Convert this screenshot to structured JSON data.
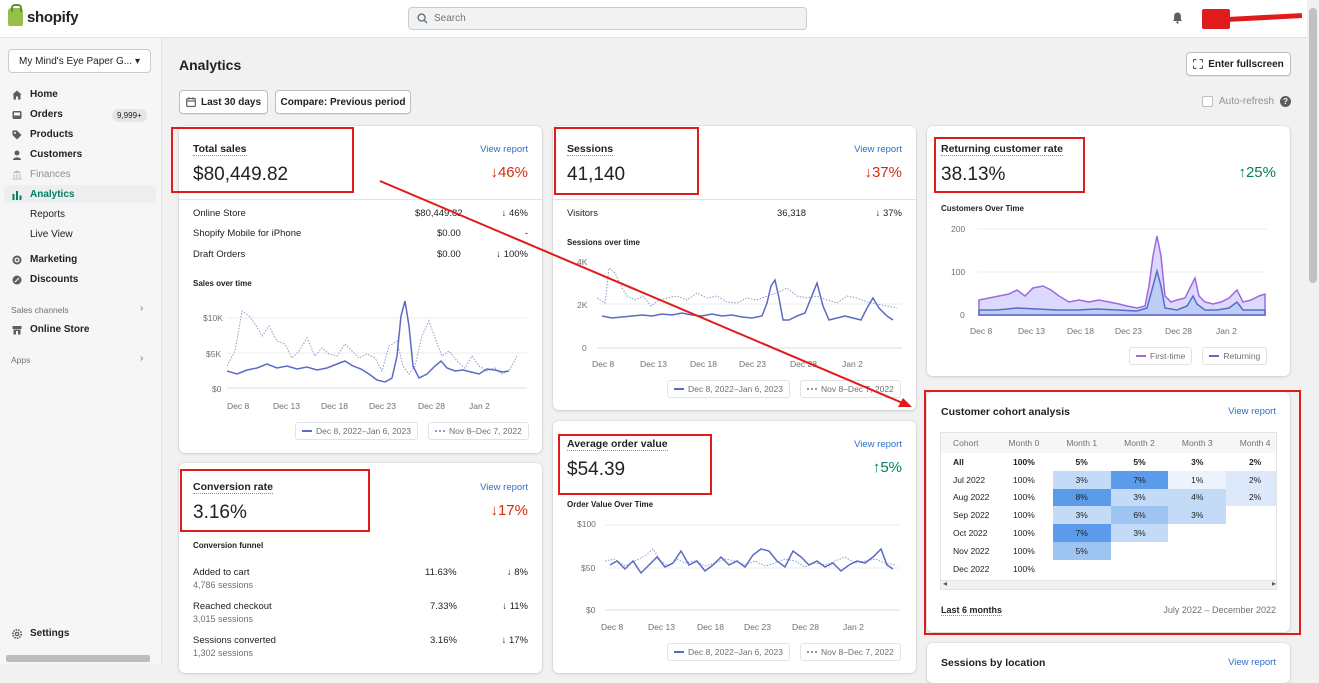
{
  "topbar": {
    "logo_text": "shopify",
    "search_placeholder": "Search"
  },
  "sidebar": {
    "store_name": "My Mind's Eye Paper G...",
    "items": [
      {
        "label": "Home",
        "icon": "home-icon"
      },
      {
        "label": "Orders",
        "icon": "orders-icon",
        "badge": "9,999+"
      },
      {
        "label": "Products",
        "icon": "tag-icon"
      },
      {
        "label": "Customers",
        "icon": "person-icon"
      },
      {
        "label": "Finances",
        "icon": "bank-icon"
      },
      {
        "label": "Analytics",
        "icon": "bar-chart-icon"
      },
      {
        "label": "Reports"
      },
      {
        "label": "Live View"
      },
      {
        "label": "Marketing",
        "icon": "target-icon"
      },
      {
        "label": "Discounts",
        "icon": "discount-icon"
      }
    ],
    "sales_channels_label": "Sales channels",
    "online_store_label": "Online Store",
    "apps_label": "Apps",
    "settings_label": "Settings"
  },
  "page": {
    "title": "Analytics",
    "fullscreen_label": "Enter fullscreen",
    "date_range_label": "Last 30 days",
    "compare_label": "Compare: Previous period",
    "auto_refresh_label": "Auto-refresh"
  },
  "view_report": "View report",
  "total_sales": {
    "title": "Total sales",
    "value": "$80,449.82",
    "change": "46%",
    "direction": "down",
    "rows": [
      {
        "label": "Online Store",
        "value": "$80,449.82",
        "change": "46%"
      },
      {
        "label": "Shopify Mobile for iPhone",
        "value": "$0.00",
        "change": "-"
      },
      {
        "label": "Draft Orders",
        "value": "$0.00",
        "change": "100%"
      }
    ],
    "chart_label": "Sales over time",
    "y_ticks": [
      "$10K",
      "$5K",
      "$0"
    ],
    "x_ticks": [
      "Dec 8",
      "Dec 13",
      "Dec 18",
      "Dec 23",
      "Dec 28",
      "Jan 2"
    ],
    "legend_current": "Dec 8, 2022–Jan 6, 2023",
    "legend_previous": "Nov 8–Dec 7, 2022"
  },
  "sessions": {
    "title": "Sessions",
    "value": "41,140",
    "change": "37%",
    "direction": "down",
    "visitors_label": "Visitors",
    "visitors_value": "36,318",
    "visitors_change": "37%",
    "chart_label": "Sessions over time",
    "y_ticks": [
      "4K",
      "2K",
      "0"
    ],
    "x_ticks": [
      "Dec 8",
      "Dec 13",
      "Dec 18",
      "Dec 23",
      "Dec 28",
      "Jan 2"
    ],
    "legend_current": "Dec 8, 2022–Jan 6, 2023",
    "legend_previous": "Nov 8–Dec 7, 2022"
  },
  "returning": {
    "title": "Returning customer rate",
    "value": "38.13%",
    "change": "25%",
    "direction": "up",
    "chart_label": "Customers Over Time",
    "y_ticks": [
      "200",
      "100",
      "0"
    ],
    "x_ticks": [
      "Dec 8",
      "Dec 13",
      "Dec 18",
      "Dec 23",
      "Dec 28",
      "Jan 2"
    ],
    "legend_first": "First-time",
    "legend_returning": "Returning"
  },
  "conversion": {
    "title": "Conversion rate",
    "value": "3.16%",
    "change": "17%",
    "direction": "down",
    "funnel_label": "Conversion funnel",
    "rows": [
      {
        "label": "Added to cart",
        "sub": "4,786 sessions",
        "value": "11.63%",
        "change": "8%"
      },
      {
        "label": "Reached checkout",
        "sub": "3,015 sessions",
        "value": "7.33%",
        "change": "11%"
      },
      {
        "label": "Sessions converted",
        "sub": "1,302 sessions",
        "value": "3.16%",
        "change": "17%"
      }
    ]
  },
  "aov": {
    "title": "Average order value",
    "value": "$54.39",
    "change": "5%",
    "direction": "up",
    "chart_label": "Order Value Over Time",
    "y_ticks": [
      "$100",
      "$50",
      "$0"
    ],
    "x_ticks": [
      "Dec 8",
      "Dec 13",
      "Dec 18",
      "Dec 23",
      "Dec 28",
      "Jan 2"
    ],
    "legend_current": "Dec 8, 2022–Jan 6, 2023",
    "legend_previous": "Nov 8–Dec 7, 2022"
  },
  "cohort": {
    "title": "Customer cohort analysis",
    "headers": [
      "Cohort",
      "Month 0",
      "Month 1",
      "Month 2",
      "Month 3",
      "Month 4"
    ],
    "rows": [
      [
        "All",
        "100%",
        "5%",
        "5%",
        "3%",
        "2%"
      ],
      [
        "Jul 2022",
        "100%",
        "3%",
        "7%",
        "1%",
        "2%"
      ],
      [
        "Aug 2022",
        "100%",
        "8%",
        "3%",
        "4%",
        "2%"
      ],
      [
        "Sep 2022",
        "100%",
        "3%",
        "6%",
        "3%",
        ""
      ],
      [
        "Oct 2022",
        "100%",
        "7%",
        "3%",
        "",
        ""
      ],
      [
        "Nov 2022",
        "100%",
        "5%",
        "",
        "",
        ""
      ],
      [
        "Dec 2022",
        "100%",
        "",
        "",
        "",
        ""
      ]
    ],
    "footer_left": "Last 6 months",
    "footer_right": "July 2022 – December 2022"
  },
  "sessions_by_location": {
    "title": "Sessions by location"
  },
  "colors": {
    "accent": "#008060",
    "down": "#d72c0d",
    "link": "#2c6ecb",
    "series": "#5c6ac4",
    "annotation": "#e01b1b"
  }
}
